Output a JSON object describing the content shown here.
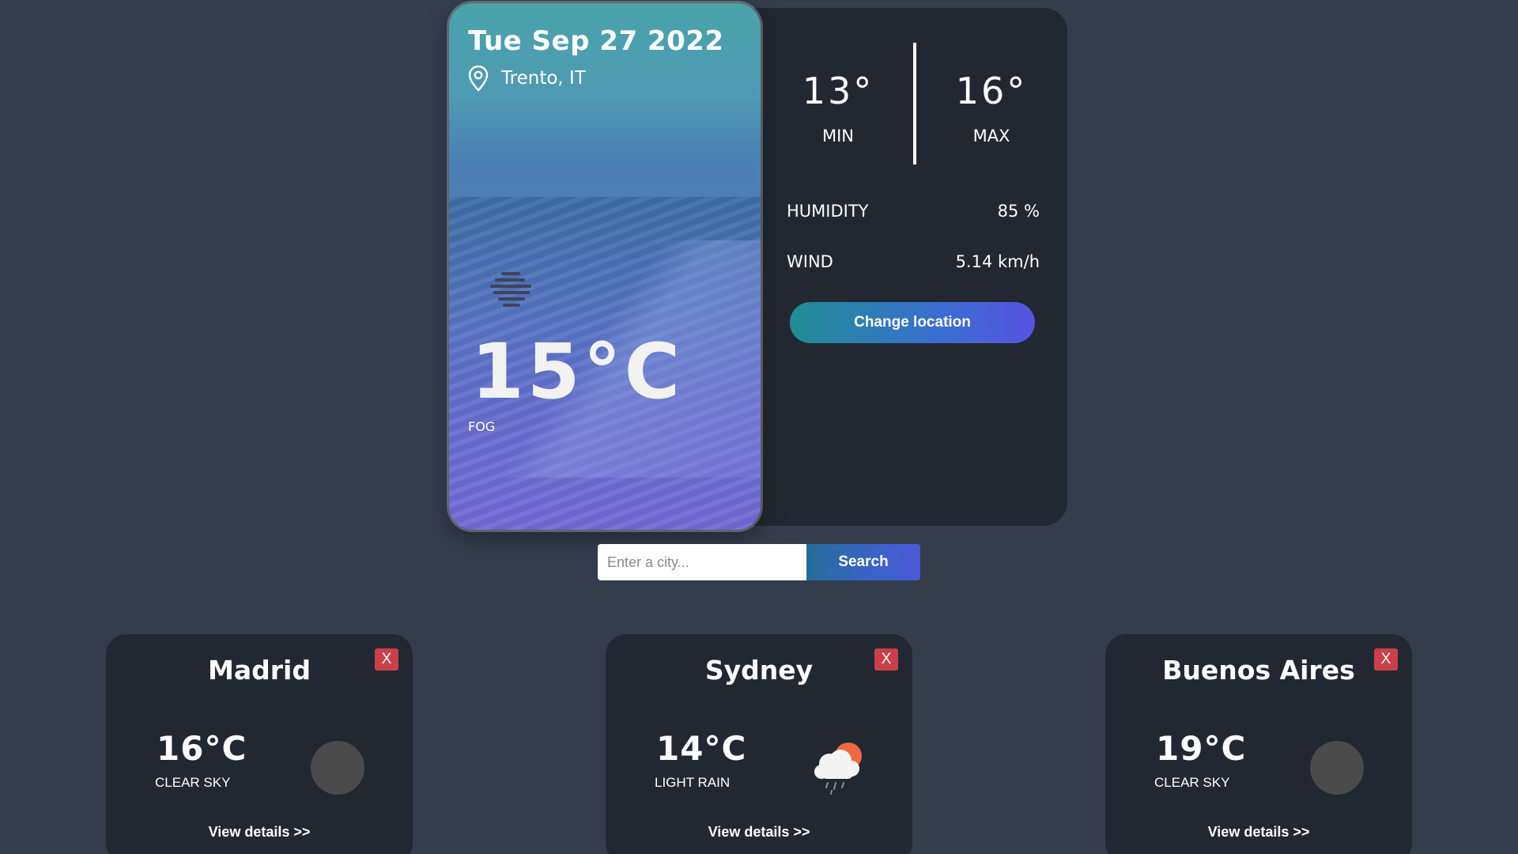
{
  "current": {
    "date": "Tue Sep 27 2022",
    "location": "Trento, IT",
    "temperature": "15°C",
    "description": "FOG",
    "icon": "fog-icon"
  },
  "details": {
    "min_value": "13°",
    "min_label": "MIN",
    "max_value": "16°",
    "max_label": "MAX",
    "humidity_label": "HUMIDITY",
    "humidity_value": "85 %",
    "wind_label": "WIND",
    "wind_value": "5.14 km/h",
    "change_location_label": "Change location"
  },
  "search": {
    "placeholder": "Enter a city...",
    "value": "",
    "button_label": "Search"
  },
  "cities": [
    {
      "name": "Madrid",
      "temperature": "16°C",
      "description": "CLEAR SKY",
      "icon": "clear-sky-icon",
      "remove_label": "X",
      "details_label": "View details >>"
    },
    {
      "name": "Sydney",
      "temperature": "14°C",
      "description": "LIGHT RAIN",
      "icon": "light-rain-icon",
      "remove_label": "X",
      "details_label": "View details >>"
    },
    {
      "name": "Buenos Aires",
      "temperature": "19°C",
      "description": "CLEAR SKY",
      "icon": "clear-sky-icon",
      "remove_label": "X",
      "details_label": "View details >>"
    }
  ],
  "colors": {
    "background": "#343d4c",
    "panel": "#222832",
    "accent_start": "#1f8e94",
    "accent_end": "#5552e0",
    "remove": "#c9404a"
  }
}
